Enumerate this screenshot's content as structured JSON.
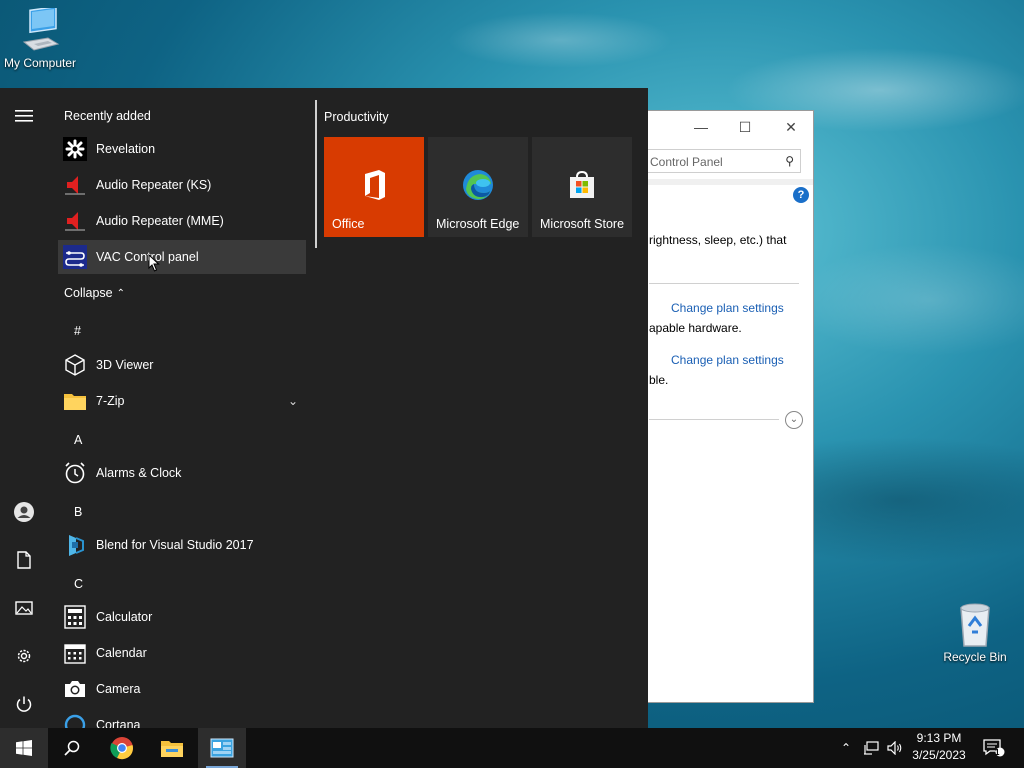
{
  "desktop": {
    "my_computer_label": "My Computer",
    "recycle_bin_label": "Recycle Bin"
  },
  "control_panel": {
    "search_placeholder": "Control Panel",
    "text_1": "rightness, sleep, etc.) that",
    "link_1": "Change plan settings",
    "text_2": "apable hardware.",
    "link_2": "Change plan settings",
    "text_3": "ble.",
    "help_label": "?"
  },
  "start_menu": {
    "recently_added_label": "Recently added",
    "recent_apps": [
      {
        "label": "Revelation",
        "icon": "revelation-icon"
      },
      {
        "label": "Audio Repeater (KS)",
        "icon": "audio-repeater-icon"
      },
      {
        "label": "Audio Repeater (MME)",
        "icon": "audio-repeater-icon"
      },
      {
        "label": "VAC Control panel",
        "icon": "vac-control-icon"
      }
    ],
    "collapse_label": "Collapse",
    "groups": [
      {
        "letter": "#",
        "apps": [
          {
            "label": "3D Viewer",
            "icon": "3d-viewer-icon"
          },
          {
            "label": "7-Zip",
            "icon": "folder-icon"
          }
        ]
      },
      {
        "letter": "A",
        "apps": [
          {
            "label": "Alarms & Clock",
            "icon": "alarm-clock-icon"
          }
        ]
      },
      {
        "letter": "B",
        "apps": [
          {
            "label": "Blend for Visual Studio 2017",
            "icon": "blend-icon"
          }
        ]
      },
      {
        "letter": "C",
        "apps": [
          {
            "label": "Calculator",
            "icon": "calculator-icon"
          },
          {
            "label": "Calendar",
            "icon": "calendar-icon"
          },
          {
            "label": "Camera",
            "icon": "camera-icon"
          },
          {
            "label": "Cortana",
            "icon": "cortana-icon"
          }
        ]
      }
    ],
    "tiles_group_label": "Productivity",
    "tiles": [
      {
        "label": "Office",
        "color": "#d83b01",
        "icon": "office-icon"
      },
      {
        "label": "Microsoft Edge",
        "color": "#2d2d2d",
        "icon": "edge-icon"
      },
      {
        "label": "Microsoft Store",
        "color": "#2d2d2d",
        "icon": "store-icon"
      }
    ]
  },
  "taskbar": {
    "time": "9:13 PM",
    "date": "3/25/2023",
    "notification_count": "1"
  }
}
